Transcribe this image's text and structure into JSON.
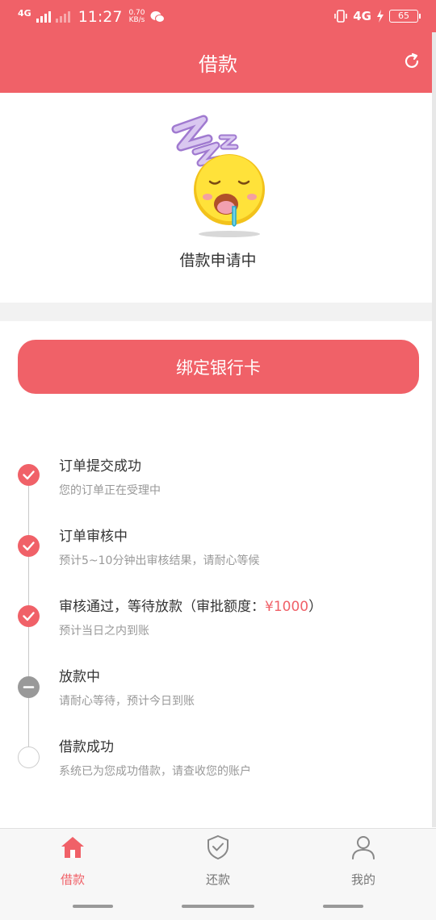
{
  "status_bar": {
    "network_left": "4G",
    "time": "11:27",
    "speed_value": "0.70",
    "speed_unit": "KB/s",
    "network_right": "4G",
    "battery": "65"
  },
  "header": {
    "title": "借款",
    "refresh_icon": "refresh-icon"
  },
  "status": {
    "icon": "sleeping-emoji",
    "text": "借款申请中"
  },
  "bind_button": {
    "label": "绑定银行卡"
  },
  "timeline": {
    "steps": [
      {
        "title": "订单提交成功",
        "desc": "您的订单正在受理中",
        "state": "done"
      },
      {
        "title": "订单审核中",
        "desc": "预计5~10分钟出审核结果，请耐心等候",
        "state": "done"
      },
      {
        "title_prefix": "审核通过，等待放款（审批额度：",
        "amount": "¥1000",
        "title_suffix": "）",
        "desc": "预计当日之内到账",
        "state": "done"
      },
      {
        "title": "放款中",
        "desc": "请耐心等待，预计今日到账",
        "state": "pending"
      },
      {
        "title": "借款成功",
        "desc": "系统已为您成功借款，请查收您的账户",
        "state": "todo"
      }
    ]
  },
  "bottom_nav": {
    "items": [
      {
        "label": "借款",
        "icon": "home-icon",
        "active": true
      },
      {
        "label": "还款",
        "icon": "shield-check-icon",
        "active": false
      },
      {
        "label": "我的",
        "icon": "user-icon",
        "active": false
      }
    ]
  },
  "colors": {
    "accent": "#f06168",
    "text_primary": "#333333",
    "text_secondary": "#999999",
    "background_band": "#f2f2f2"
  }
}
